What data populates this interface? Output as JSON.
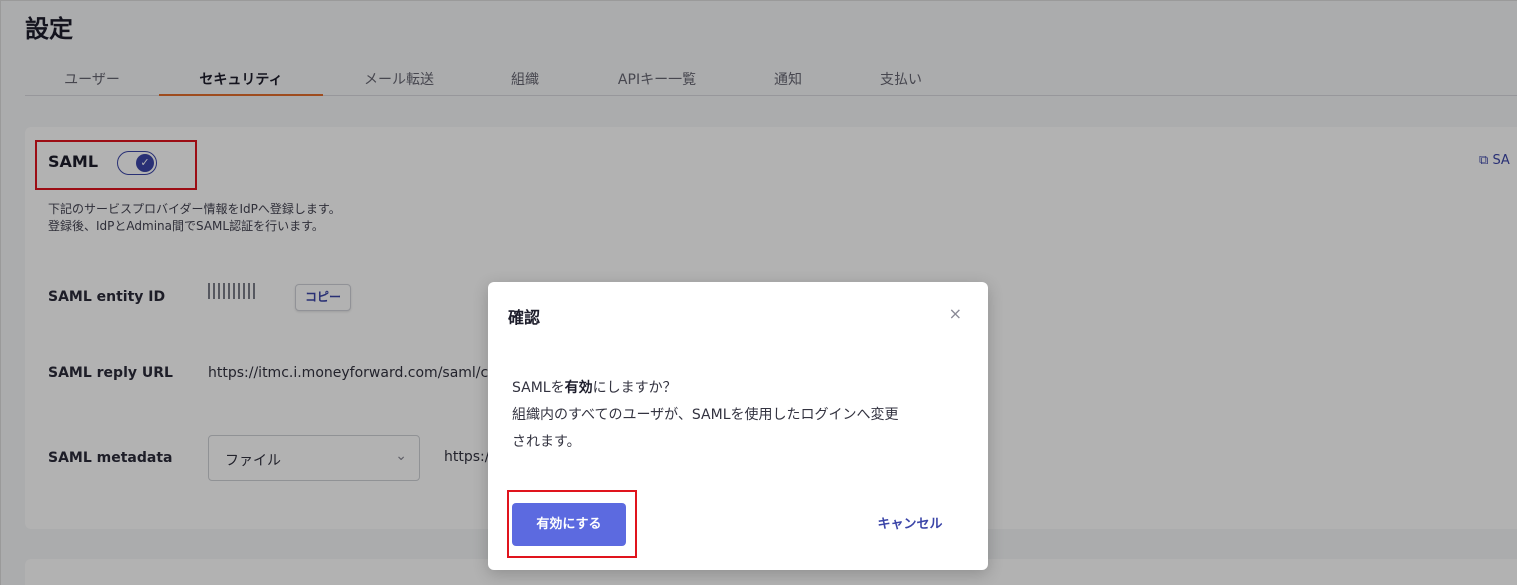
{
  "page": {
    "title": "設定"
  },
  "tabs": [
    {
      "label": "ユーザー"
    },
    {
      "label": "セキュリティ"
    },
    {
      "label": "メール転送"
    },
    {
      "label": "組織"
    },
    {
      "label": "APIキー一覧"
    },
    {
      "label": "通知"
    },
    {
      "label": "支払い"
    }
  ],
  "active_tab": "セキュリティ",
  "saml": {
    "heading": "SAML",
    "enabled": true,
    "external_link_label": "SA",
    "description_line1": "下記のサービスプロバイダー情報をIdPへ登録します。",
    "description_line2": "登録後、IdPとAdmina間でSAML認証を行います。",
    "entity_id_label": "SAML entity ID",
    "copy_label": "コピー",
    "reply_url_label": "SAML reply URL",
    "reply_url_value": "https://itmc.i.moneyforward.com/saml/callb",
    "metadata_label": "SAML metadata",
    "metadata_select_value": "ファイル",
    "metadata_url_prefix": "https://"
  },
  "modal": {
    "title": "確認",
    "close_symbol": "×",
    "body_prefix": "SAMLを",
    "body_bold": "有効",
    "body_suffix": "にしますか？",
    "body_line2": "組織内のすべてのユーザが、SAMLを使用したログインへ変更",
    "body_line3": "されます。",
    "confirm_label": "有効にする",
    "cancel_label": "キャンセル"
  },
  "colors": {
    "accent": "#3b45a8",
    "primary_button": "#5c6ae0",
    "active_tab_underline": "#e36d2c",
    "highlight_box": "#e0141d"
  }
}
